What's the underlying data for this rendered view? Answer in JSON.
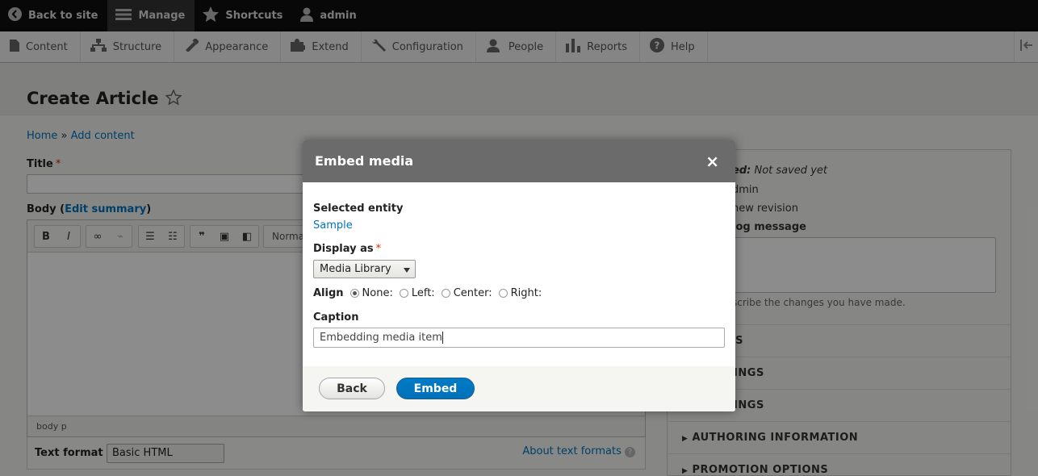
{
  "toolbar": {
    "back_to_site": "Back to site",
    "manage": "Manage",
    "shortcuts": "Shortcuts",
    "user": "admin"
  },
  "tray": {
    "items": [
      "Content",
      "Structure",
      "Appearance",
      "Extend",
      "Configuration",
      "People",
      "Reports",
      "Help"
    ]
  },
  "page": {
    "title": "Create Article",
    "breadcrumb": {
      "home": "Home",
      "separator": "»",
      "add_content": "Add content"
    },
    "title_label": "Title",
    "body_label": "Body (",
    "edit_summary": "Edit summary",
    "body_label_end": ")",
    "format_style": "Normal",
    "editor_path": "body  p",
    "text_format_label": "Text format",
    "text_format_value": "Basic HTML",
    "about_formats": "About text formats"
  },
  "sidebar": {
    "last_saved_label": "ed:",
    "last_saved_value": "Not saved yet",
    "author": "dmin",
    "new_revision": "new revision",
    "revision_log_label": "log message",
    "revision_help": "scribe the changes you have made.",
    "sections": [
      "SETTINGS",
      "NT SETTINGS",
      "TH SETTINGS",
      "AUTHORING INFORMATION",
      "PROMOTION OPTIONS"
    ]
  },
  "dialog": {
    "title": "Embed media",
    "close": "×",
    "selected_entity_label": "Selected entity",
    "entity_name": "Sample",
    "display_as_label": "Display as",
    "display_as_value": "Media Library",
    "align_label": "Align",
    "align_options": [
      "None:",
      "Left:",
      "Center:",
      "Right:"
    ],
    "align_selected": "None:",
    "caption_label": "Caption",
    "caption_value": "Embedding media item",
    "back_button": "Back",
    "embed_button": "Embed"
  }
}
